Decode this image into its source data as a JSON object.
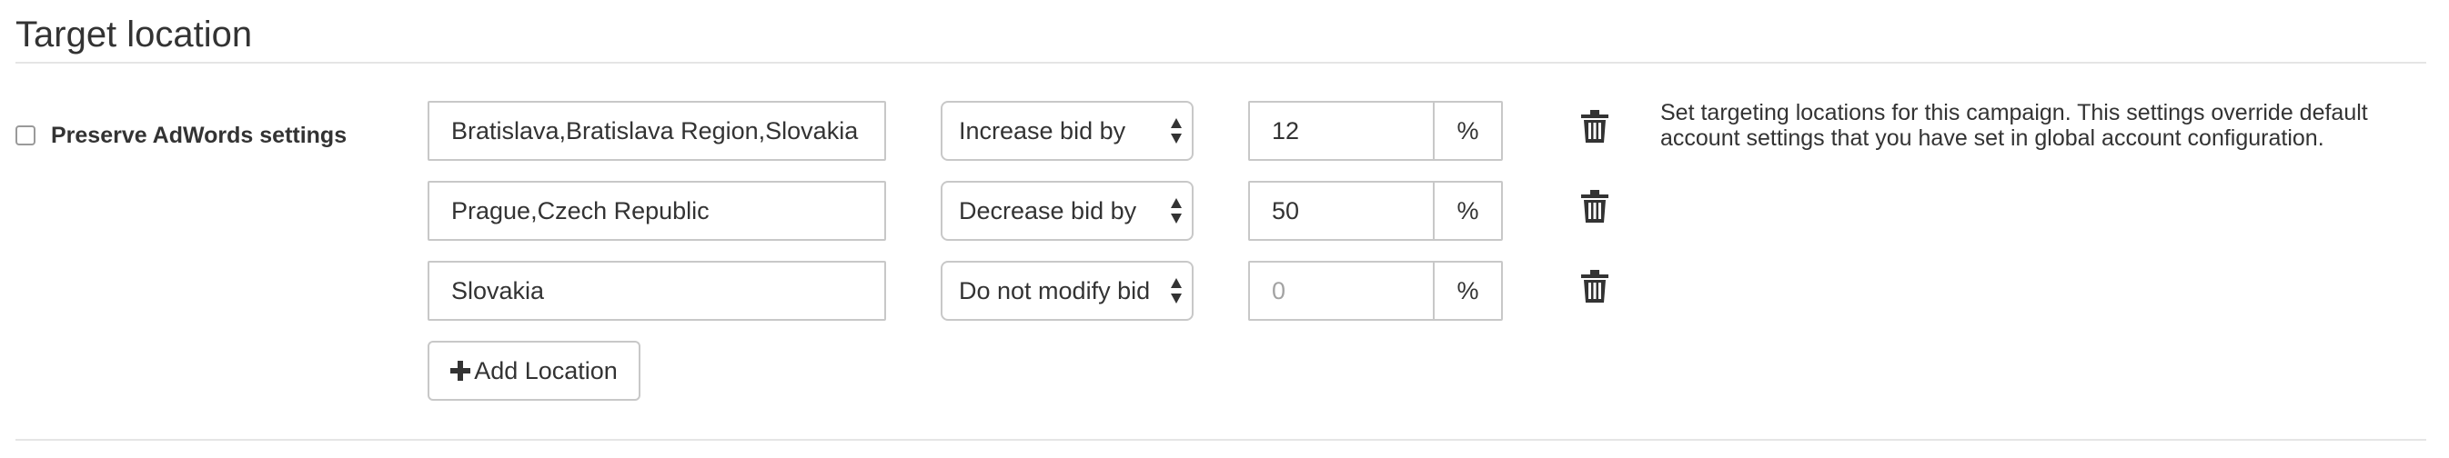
{
  "section": {
    "title": "Target location"
  },
  "preserve": {
    "label": "Preserve AdWords settings",
    "checked": false
  },
  "locations": [
    {
      "location": "Bratislava,Bratislava Region,Slovakia",
      "bid_mode": "Increase bid by",
      "value": "12",
      "placeholder": "",
      "unit": "%"
    },
    {
      "location": "Prague,Czech Republic",
      "bid_mode": "Decrease bid by",
      "value": "50",
      "placeholder": "",
      "unit": "%"
    },
    {
      "location": "Slovakia",
      "bid_mode": "Do not modify bid",
      "value": "",
      "placeholder": "0",
      "unit": "%"
    }
  ],
  "add_button": {
    "label": "Add Location",
    "icon": "plus-icon"
  },
  "help_text": "Set targeting locations for this campaign. This settings override default account settings that you have set in global account configuration.",
  "icons": {
    "delete": "trash-icon",
    "select": "sort-arrows-icon"
  }
}
